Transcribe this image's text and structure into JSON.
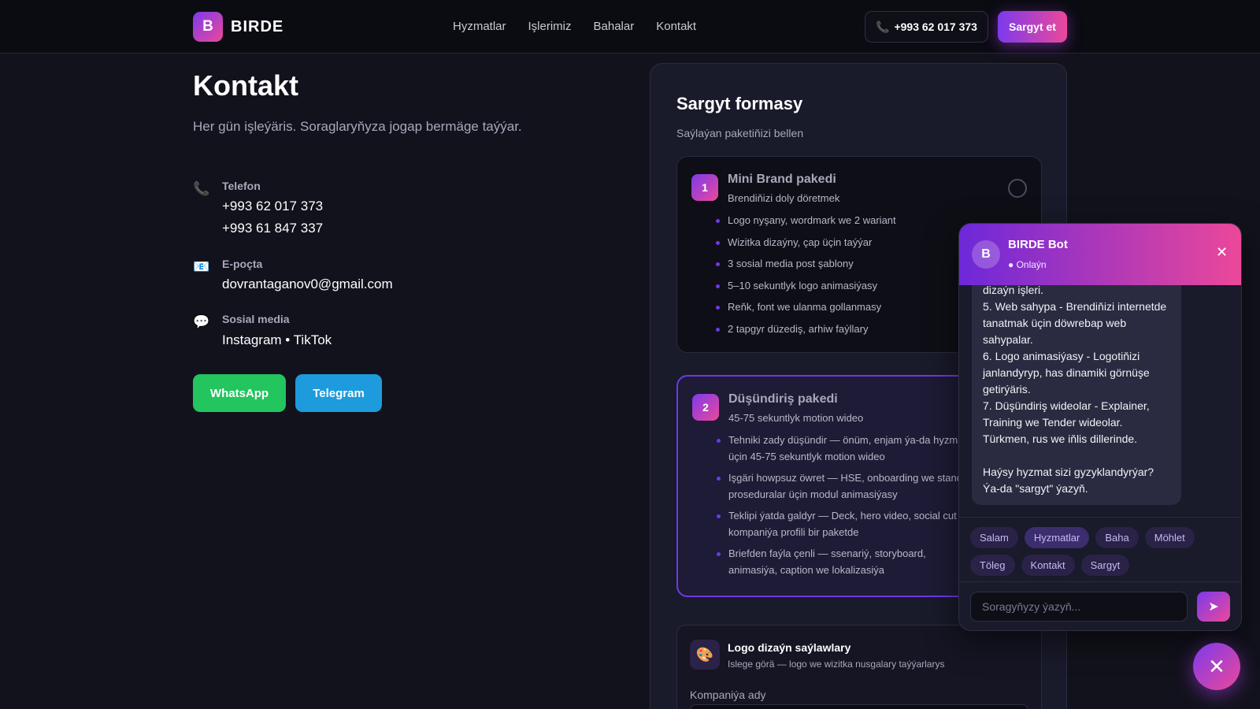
{
  "nav": {
    "logo_letter": "B",
    "brand": "BIRDE",
    "links": [
      "Hyzmatlar",
      "Işlerimiz",
      "Bahalar",
      "Kontakt"
    ],
    "phone_icon": "📞",
    "phone": "+993 62 017 373",
    "order_label": "Sargyt et"
  },
  "contact": {
    "title": "Kontakt",
    "subtitle": "Her gün işleýäris. Soraglaryňyza jogap bermäge taýýar.",
    "phone": {
      "icon": "📞",
      "label": "Telefon",
      "values": [
        "+993 62 017 373",
        "+993 61 847 337"
      ]
    },
    "email": {
      "icon": "📧",
      "label": "E-poçta",
      "value": "dovrantaganov0@gmail.com"
    },
    "social": {
      "icon": "💬",
      "label": "Sosial media",
      "value": "Instagram • TikTok"
    },
    "whatsapp_label": "WhatsApp",
    "telegram_label": "Telegram"
  },
  "form": {
    "title": "Sargyt formasy",
    "subtitle": "Saýlaýan paketiňizi bellen",
    "packages": [
      {
        "num": "1",
        "name": "Mini Brand pakedi",
        "desc": "Brendiňizi doly döretmek",
        "items": [
          "Logo nyşany, wordmark we 2 wariant",
          "Wizitka dizaýny, çap üçin taýýar",
          "3 sosial media post şablony",
          "5–10 sekuntlyk logo animasiýasy",
          "Reňk, font we ulanma gollanmasy",
          "2 tapgyr düzediş, arhiw faýllary"
        ]
      },
      {
        "num": "2",
        "name": "Düşündiriş pakedi",
        "desc": "45-75 sekuntlyk motion wideo",
        "items": [
          "Tehniki zady düşündir — önüm, enjam ýa-da hyzmat üçin 45-75 sekuntlyk motion wideo",
          "Işgäri howpsuz öwret — HSE, onboarding we standart proseduralar üçin modul animasiýasy",
          "Teklipi ýatda galdyr — Deck, hero video, social cut we kompaniýa profili bir paketde",
          "Briefden faýla çenli — ssenariý, storyboard, animasiýa, caption we lokalizasiýa"
        ]
      }
    ],
    "logo_options": {
      "icon": "🎨",
      "title": "Logo dizaýn saýlawlary",
      "subtitle": "Islege görä — logo we wizitka nusgalary taýýarlarys"
    },
    "company_label": "Kompaniýa ady"
  },
  "chat": {
    "avatar_letter": "B",
    "name": "BIRDE Bot",
    "status": "● Onlaýn",
    "close_icon": "✕",
    "message": "dizaýn işleri.\n5. Web sahypa - Brendiňizi internetde tanatmak üçin döwrebap web sahypalar.\n6. Logo animasiýasy - Logotiňizi janlandyryp, has dinamiki görnüşe getirýäris.\n7. Düşündiriş wideolar - Explainer, Training we Tender wideolar. Türkmen, rus we iňlis dillerinde.\n\nHaýsy hyzmat sizi gyzyklandyrýar? Ýa-da \"sargyt\" ýazyň.",
    "chips": [
      "Salam",
      "Hyzmatlar",
      "Baha",
      "Möhlet",
      "Töleg",
      "Kontakt",
      "Sargyt"
    ],
    "input_placeholder": "Soragyňyzy ýazyň...",
    "send_icon": "➤"
  },
  "fab_icon": "✕",
  "colors": {
    "accent_start": "#7c3aed",
    "accent_end": "#ec4899",
    "whatsapp": "#22c55e",
    "telegram": "#1d9bdc",
    "background": "#12121c"
  }
}
